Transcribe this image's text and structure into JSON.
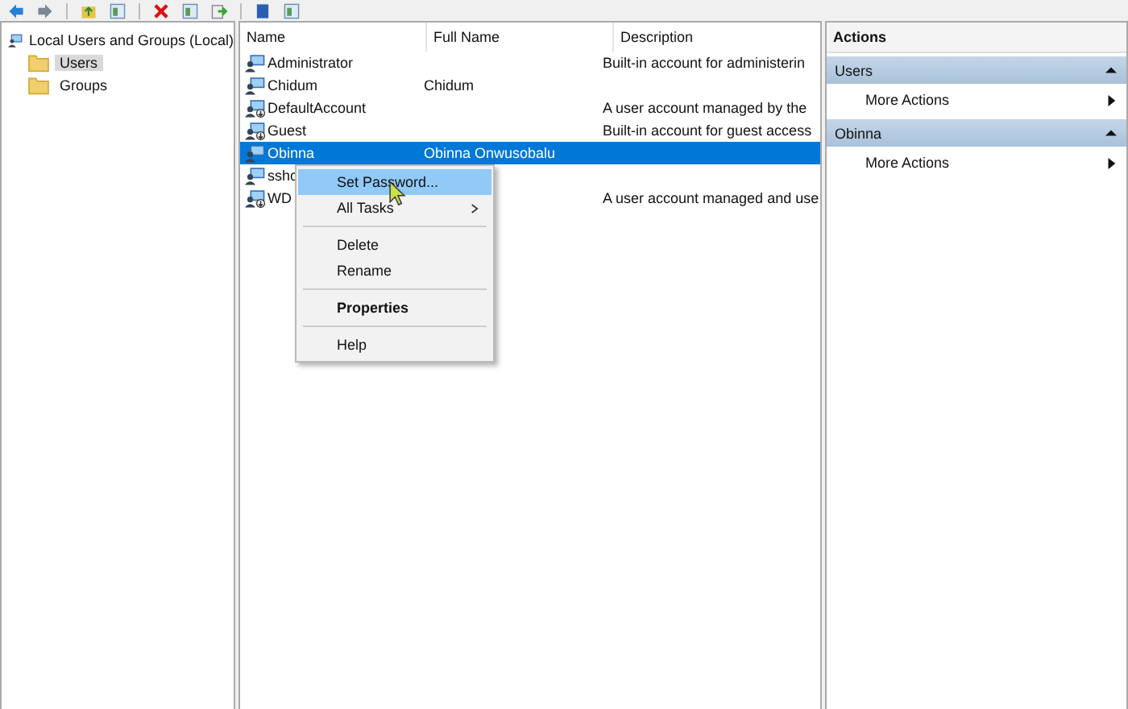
{
  "tree": {
    "label": "Local Users and Groups (Local)",
    "children": [
      {
        "label": "Users",
        "selected": true
      },
      {
        "label": "Groups",
        "selected": false
      }
    ]
  },
  "table": {
    "columns": [
      "Name",
      "Full Name",
      "Description"
    ],
    "rows": [
      {
        "cells": [
          "Administrator",
          "",
          "Built-in account for administerin"
        ],
        "disabled": false,
        "selected": false
      },
      {
        "cells": [
          "Chidum",
          "Chidum",
          ""
        ],
        "disabled": false,
        "selected": false
      },
      {
        "cells": [
          "DefaultAccount",
          "",
          "A user account managed by the"
        ],
        "disabled": true,
        "selected": false
      },
      {
        "cells": [
          "Guest",
          "",
          "Built-in account for guest access"
        ],
        "disabled": true,
        "selected": false
      },
      {
        "cells": [
          "Obinna",
          "Obinna Onwusobalu",
          ""
        ],
        "disabled": false,
        "selected": true
      },
      {
        "cells": [
          "sshc",
          "",
          ""
        ],
        "disabled": false,
        "selected": false
      },
      {
        "cells": [
          "WD",
          "",
          "A user account managed and use"
        ],
        "disabled": true,
        "selected": false
      }
    ]
  },
  "context_menu": {
    "items": [
      {
        "kind": "item",
        "label": "Set Password...",
        "selected": true,
        "bold": false,
        "submenu": false
      },
      {
        "kind": "item",
        "label": "All Tasks",
        "selected": false,
        "bold": false,
        "submenu": true
      },
      {
        "kind": "separator"
      },
      {
        "kind": "item",
        "label": "Delete",
        "selected": false,
        "bold": false,
        "submenu": false
      },
      {
        "kind": "item",
        "label": "Rename",
        "selected": false,
        "bold": false,
        "submenu": false
      },
      {
        "kind": "separator"
      },
      {
        "kind": "item",
        "label": "Properties",
        "selected": false,
        "bold": true,
        "submenu": false
      },
      {
        "kind": "separator"
      },
      {
        "kind": "item",
        "label": "Help",
        "selected": false,
        "bold": false,
        "submenu": false
      }
    ]
  },
  "actions": {
    "title": "Actions",
    "sections": [
      {
        "title": "Users",
        "expanded": true,
        "items": [
          "More Actions"
        ]
      },
      {
        "title": "Obinna",
        "expanded": true,
        "items": [
          "More Actions"
        ]
      }
    ]
  }
}
